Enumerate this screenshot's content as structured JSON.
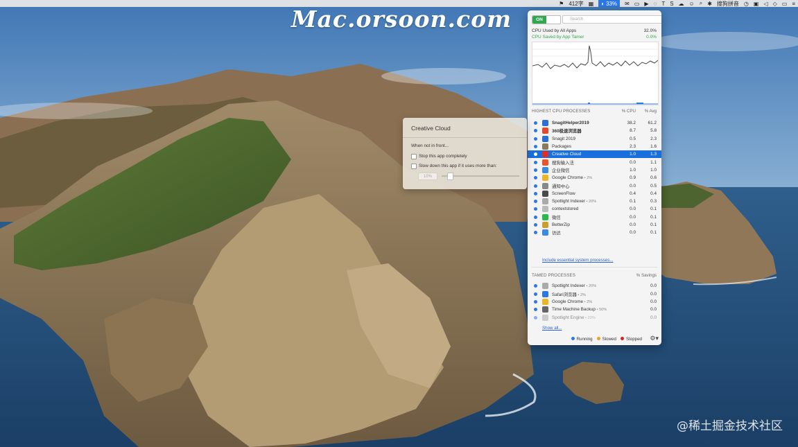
{
  "watermarks": {
    "brand": "Mac.orsoon.com",
    "site": "@稀土掘金技术社区"
  },
  "menubar": {
    "word_count": "412字",
    "cpu_percent": "33%",
    "input_method": "搜狗拼音"
  },
  "app_tamer": {
    "toggle_label": "ON",
    "search_placeholder": "Search",
    "cpu_used_label": "CPU Used by All Apps",
    "cpu_used_value": "32.0%",
    "cpu_saved_label": "CPU Saved by App Tamer",
    "cpu_saved_value": "0.0%",
    "highest_header": "HIGHEST CPU PROCESSES",
    "col_cpu": "% CPU",
    "col_avg": "% Avg",
    "processes": [
      {
        "name": "SnagitHelper2019",
        "cpu": "38.2",
        "avg": "61.2",
        "bold": true,
        "icon_color": "#2b6fd6"
      },
      {
        "name": "360极速浏览器",
        "cpu": "8.7",
        "avg": "5.8",
        "bold": true,
        "icon_color": "#e04a2f"
      },
      {
        "name": "Snagit 2019",
        "cpu": "0.5",
        "avg": "2.3",
        "bold": false,
        "icon_color": "#2b6fd6"
      },
      {
        "name": "Packages",
        "cpu": "2.3",
        "avg": "1.6",
        "bold": false,
        "icon_color": "#8a7a5a"
      },
      {
        "name": "Creative Cloud",
        "cpu": "1.0",
        "avg": "1.3",
        "bold": false,
        "icon_color": "#d9302c",
        "selected": true
      },
      {
        "name": "搜狗输入法",
        "cpu": "0.0",
        "avg": "1.1",
        "bold": false,
        "icon_color": "#e8552a"
      },
      {
        "name": "企业微信",
        "cpu": "1.0",
        "avg": "1.0",
        "bold": false,
        "icon_color": "#3a8ae0"
      },
      {
        "name": "Google Chrome",
        "suffix": " • 2%",
        "cpu": "0.9",
        "avg": "0.6",
        "bold": false,
        "icon_color": "#e8b82a"
      },
      {
        "name": "通知中心",
        "cpu": "0.0",
        "avg": "0.5",
        "bold": false,
        "icon_color": "#888888"
      },
      {
        "name": "ScreenFlow",
        "cpu": "0.4",
        "avg": "0.4",
        "bold": false,
        "icon_color": "#4a4a4a"
      },
      {
        "name": "Spotlight Indexer",
        "suffix": " • 20%",
        "cpu": "0.1",
        "avg": "0.3",
        "bold": false,
        "icon_color": "#aaaaaa"
      },
      {
        "name": "contextstored",
        "cpu": "0.0",
        "avg": "0.1",
        "bold": false,
        "icon_color": "#bbbbbb"
      },
      {
        "name": "微信",
        "cpu": "0.0",
        "avg": "0.1",
        "bold": false,
        "icon_color": "#2fb84a"
      },
      {
        "name": "BetterZip",
        "cpu": "0.0",
        "avg": "0.1",
        "bold": false,
        "icon_color": "#c9a030"
      },
      {
        "name": "访达",
        "cpu": "0.0",
        "avg": "0.1",
        "bold": false,
        "icon_color": "#3a8ae0"
      }
    ],
    "include_link": "Include essential system processes...",
    "tamed_header": "TAMED PROCESSES",
    "col_savings": "% Savings",
    "tamed": [
      {
        "name": "Spotlight Indexer",
        "suffix": " • 20%",
        "savings": "0.0",
        "icon_color": "#aaaaaa"
      },
      {
        "name": "Safari浏览器",
        "suffix": " • 2%",
        "savings": "0.0",
        "icon_color": "#2b78e4"
      },
      {
        "name": "Google Chrome",
        "suffix": " • 2%",
        "savings": "0.0",
        "icon_color": "#e8b82a"
      },
      {
        "name": "Time Machine Backup",
        "suffix": " • 50%",
        "savings": "0.0",
        "icon_color": "#666666"
      },
      {
        "name": "Spotlight Engine",
        "suffix": " • 20%",
        "savings": "0.0",
        "icon_color": "#aaaaaa",
        "faded": true
      }
    ],
    "show_all": "Show all...",
    "legend": {
      "running": "Running",
      "slowed": "Slowed",
      "stopped": "Stopped"
    },
    "colors": {
      "running": "#2b78e4",
      "slowed": "#f0a020",
      "stopped": "#e02020",
      "saved_green": "#2fa84f"
    }
  },
  "creative_cloud": {
    "title": "Creative Cloud",
    "when_label": "When not in front...",
    "stop_label": "Stop this app completely",
    "slow_label": "Slow down this app if it uses more than:",
    "percent": "10%"
  }
}
